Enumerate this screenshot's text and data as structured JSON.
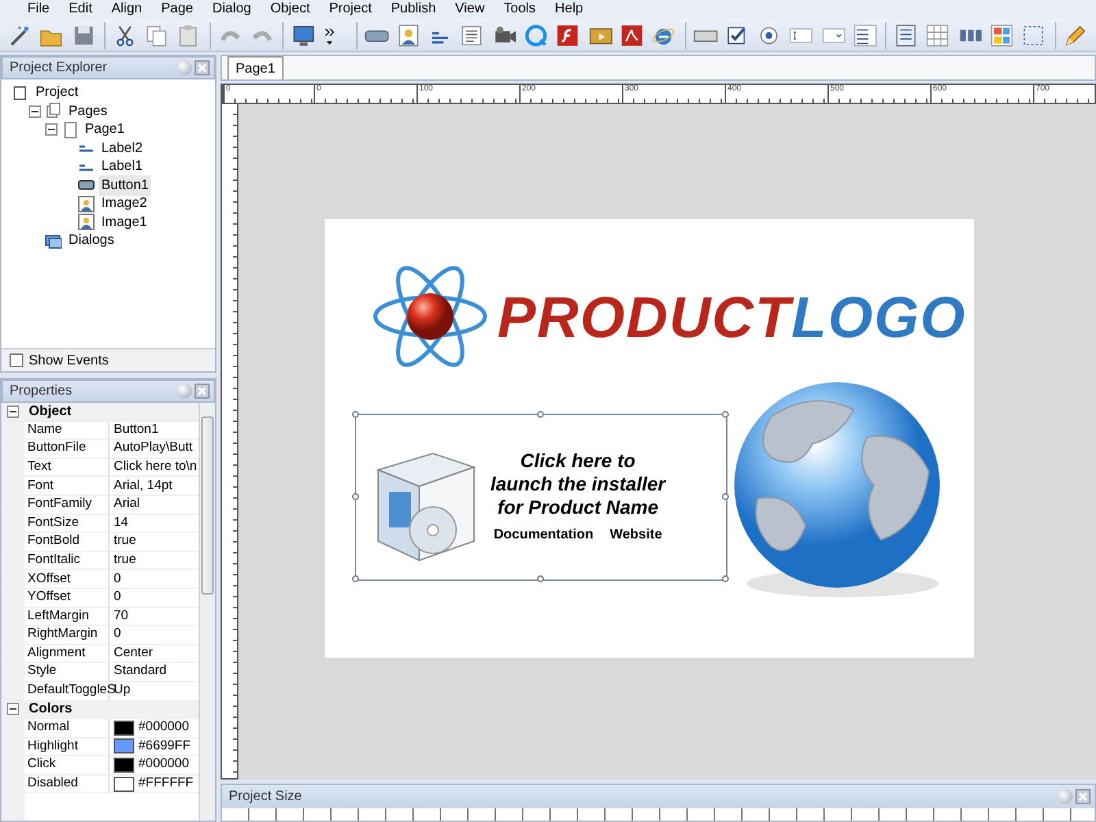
{
  "menu": [
    "File",
    "Edit",
    "Align",
    "Page",
    "Dialog",
    "Object",
    "Project",
    "Publish",
    "View",
    "Tools",
    "Help"
  ],
  "project_explorer": {
    "title": "Project Explorer",
    "tree": [
      {
        "label": "Project",
        "kind": "project",
        "selected": false,
        "children": [
          {
            "label": "Pages",
            "kind": "pages",
            "selected": false,
            "expanded": true,
            "children": [
              {
                "label": "Page1",
                "kind": "page",
                "selected": false,
                "expanded": true,
                "children": [
                  {
                    "label": "Label2",
                    "kind": "label",
                    "selected": false
                  },
                  {
                    "label": "Label1",
                    "kind": "label",
                    "selected": false
                  },
                  {
                    "label": "Button1",
                    "kind": "button",
                    "selected": true
                  },
                  {
                    "label": "Image2",
                    "kind": "image",
                    "selected": false
                  },
                  {
                    "label": "Image1",
                    "kind": "image",
                    "selected": false
                  }
                ]
              }
            ]
          },
          {
            "label": "Dialogs",
            "kind": "dialogs",
            "selected": false
          }
        ]
      }
    ],
    "show_events": {
      "label": "Show Events",
      "checked": false
    }
  },
  "properties": {
    "title": "Properties",
    "groups": [
      {
        "name": "Object",
        "expanded": true,
        "rows": [
          {
            "name": "Name",
            "value": "Button1"
          },
          {
            "name": "ButtonFile",
            "value": "AutoPlay\\Butt"
          },
          {
            "name": "Text",
            "value": "Click here to\\n"
          },
          {
            "name": "Font",
            "value": "Arial, 14pt"
          },
          {
            "name": "FontFamily",
            "value": "Arial"
          },
          {
            "name": "FontSize",
            "value": "14"
          },
          {
            "name": "FontBold",
            "value": "true"
          },
          {
            "name": "FontItalic",
            "value": "true"
          },
          {
            "name": "XOffset",
            "value": "0"
          },
          {
            "name": "YOffset",
            "value": "0"
          },
          {
            "name": "LeftMargin",
            "value": "70"
          },
          {
            "name": "RightMargin",
            "value": "0"
          },
          {
            "name": "Alignment",
            "value": "Center"
          },
          {
            "name": "Style",
            "value": "Standard"
          },
          {
            "name": "DefaultToggleS",
            "value": "Up"
          }
        ]
      },
      {
        "name": "Colors",
        "expanded": true,
        "rows": [
          {
            "name": "Normal",
            "value": "#000000",
            "color": "#000000"
          },
          {
            "name": "Highlight",
            "value": "#6699FF",
            "color": "#6699ff"
          },
          {
            "name": "Click",
            "value": "#000000",
            "color": "#000000"
          },
          {
            "name": "Disabled",
            "value": "#FFFFFF",
            "color": "#ffffff"
          }
        ]
      }
    ]
  },
  "tabs": [
    {
      "label": "Page1",
      "selected": true
    }
  ],
  "ruler": {
    "labels": [
      "0",
      "0",
      "100",
      "200",
      "300",
      "400",
      "500",
      "600",
      "700"
    ]
  },
  "canvas": {
    "logo": {
      "text_1": "PRODUCT",
      "text_2": "LOGO"
    },
    "installer_button": {
      "lines": [
        "Click here to",
        "launch the installer",
        "for Product Name"
      ],
      "links": [
        "Documentation",
        "Website"
      ]
    }
  },
  "bottom_panel": {
    "title": "Project Size"
  }
}
